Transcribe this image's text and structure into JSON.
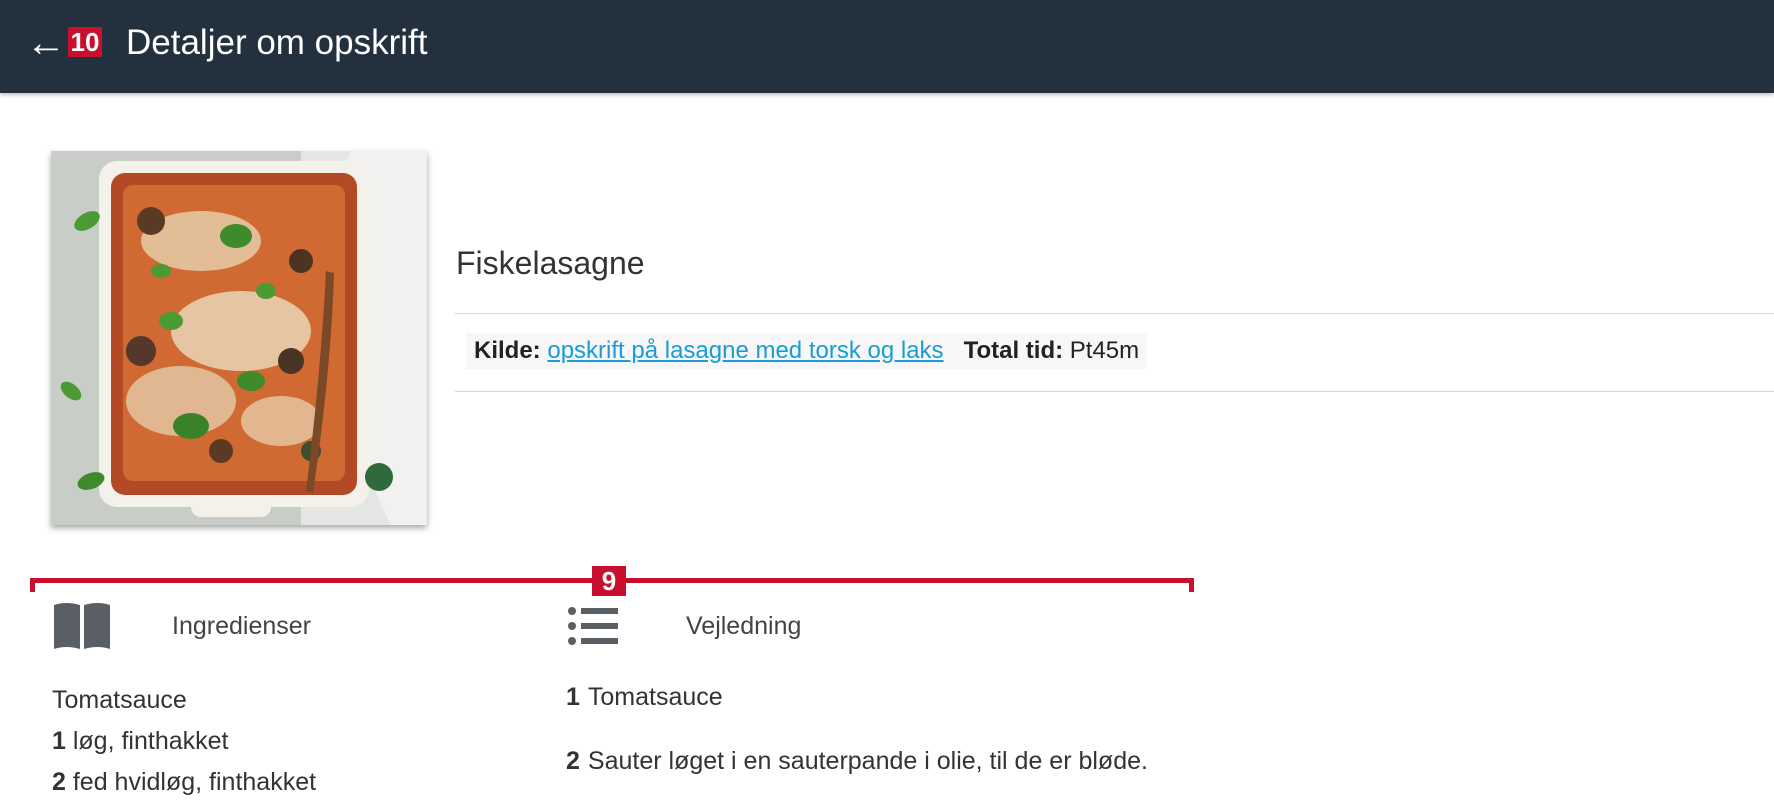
{
  "header": {
    "title": "Detaljer om opskrift",
    "back_glyph": "←",
    "badge": "10",
    "background": "#23303d"
  },
  "recipe": {
    "title": "Fiskelasagne",
    "source_label": "Kilde:",
    "source_link": "opskrift på lasagne med torsk og laks",
    "time_label": "Total tid:",
    "time_value": "Pt45m"
  },
  "annotation": {
    "badge": "9",
    "color": "#c8102e"
  },
  "tabs": {
    "ingredients": {
      "label": "Ingredienser",
      "icon": "book-icon"
    },
    "instructions": {
      "label": "Vejledning",
      "icon": "list-icon"
    }
  },
  "ingredients": {
    "heading": "Tomatsauce",
    "items": [
      {
        "qty": "1",
        "text": " løg, finthakket"
      },
      {
        "qty": "2",
        "text": " fed hvidløg, finthakket"
      }
    ]
  },
  "steps": [
    {
      "num": "1",
      "text": "Tomatsauce"
    },
    {
      "num": "2",
      "text": "Sauter løget i en sauterpande i olie, til de er bløde."
    }
  ],
  "colors": {
    "link": "#1a9cd8",
    "accent": "#c8102e"
  }
}
